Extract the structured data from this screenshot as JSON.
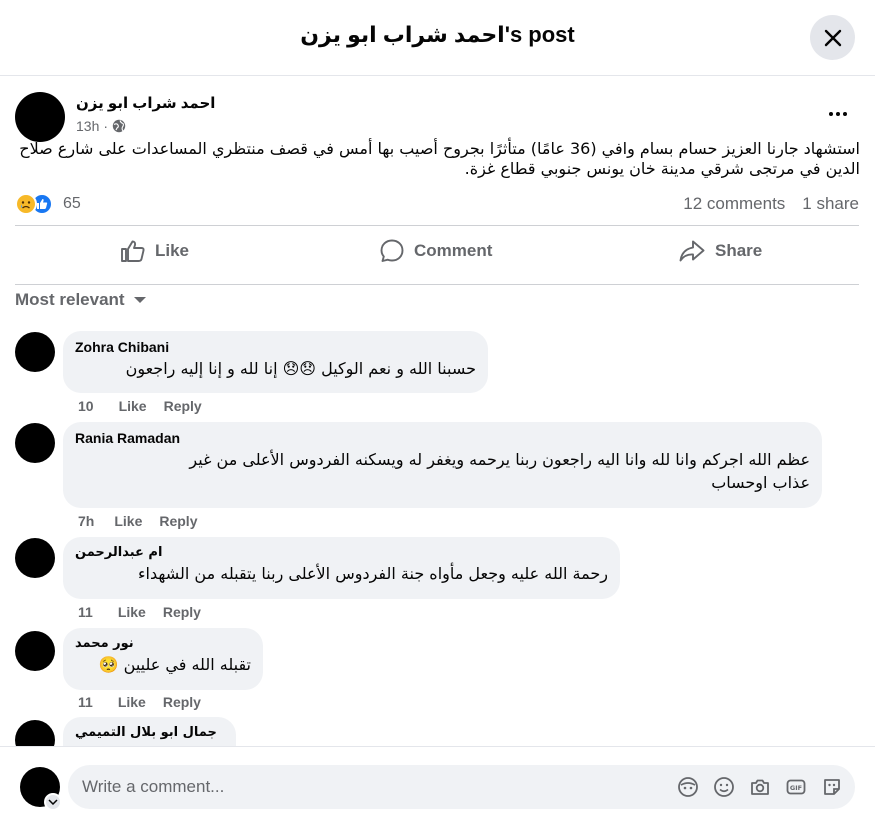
{
  "header": {
    "title": "احمد شراب ابو يزن's post"
  },
  "post": {
    "author": "احمد شراب ابو يزن",
    "time": "13h",
    "privacy_icon": "globe-icon",
    "text": "استشهاد جارنا العزيز حسام بسام وافي (36 عامًا) متأثرًا بجروح أصيب بها أمس في قصف منتظري المساعدات على شارع صلاح الدين في مرتجى شرقي مدينة خان يونس جنوبي قطاع غزة.",
    "reaction_count": "65",
    "comments_count": "12 comments",
    "shares_count": "1 share"
  },
  "actions": {
    "like": "Like",
    "comment": "Comment",
    "share": "Share"
  },
  "sort": {
    "label": "Most relevant"
  },
  "comments": [
    {
      "name": "Zohra Chibani",
      "text": "حسبنا الله و نعم الوكيل 😞😞 إنا لله و إنا إليه راجعون",
      "time": "10",
      "like": "Like",
      "reply": "Reply"
    },
    {
      "name": "Rania Ramadan",
      "text": "عظم الله اجركم وانا لله وانا اليه راجعون ربنا يرحمه ويغفر له ويسكنه الفردوس الأعلى من غير عذاب اوحساب",
      "time": "7h",
      "like": "Like",
      "reply": "Reply"
    },
    {
      "name": "ام عبدالرحمن",
      "text": "رحمة الله عليه وجعل مأواه جنة الفردوس الأعلى ربنا يتقبله من الشهداء",
      "time": "11",
      "like": "Like",
      "reply": "Reply"
    },
    {
      "name": "نور محمد",
      "text": "تقبله الله في عليين 🥺",
      "time": "11",
      "like": "Like",
      "reply": "Reply"
    },
    {
      "name": "جمال ابو بلال التميمي",
      "text": "",
      "time": "",
      "like": "",
      "reply": ""
    }
  ],
  "composer": {
    "placeholder": "Write a comment..."
  }
}
